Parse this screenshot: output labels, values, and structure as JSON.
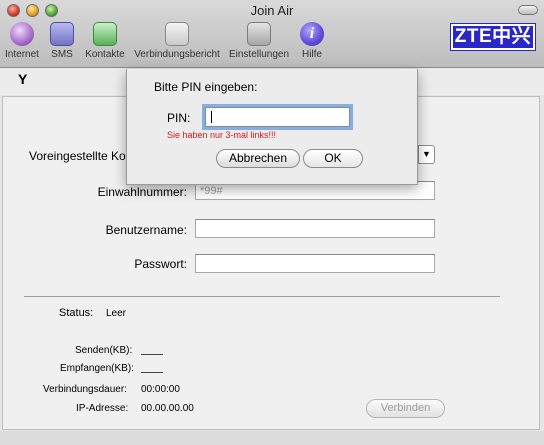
{
  "window": {
    "title": "Join Air"
  },
  "logo": {
    "text": "ZTE中兴",
    "color": "#2a27c9"
  },
  "toolbar": {
    "items": [
      {
        "label": "Internet",
        "icon": "globe-icon"
      },
      {
        "label": "SMS",
        "icon": "envelope-icon"
      },
      {
        "label": "Kontakte",
        "icon": "phone-book-icon"
      },
      {
        "label": "Verbindungsbericht",
        "icon": "report-icon"
      },
      {
        "label": "Einstellungen",
        "icon": "tools-icon"
      },
      {
        "label": "Hilfe",
        "icon": "help-icon",
        "glyph": "i"
      }
    ]
  },
  "signal": {
    "icon": "antenna-icon",
    "glyph": "Y"
  },
  "form": {
    "config_label": "Voreingestellte Ko",
    "dial_label": "Einwahlnummer:",
    "dial_value": "*99#",
    "user_label": "Benutzername:",
    "user_value": "",
    "password_label": "Passwort:",
    "password_value": ""
  },
  "status": {
    "status_label": "Status:",
    "status_value": "Leer",
    "sent_label": "Senden(KB):",
    "received_label": "Empfangen(KB):",
    "duration_label": "Verbindungsdauer:",
    "duration_value": "00:00:00",
    "ip_label": "IP-Adresse:",
    "ip_value": "00.00.00.00",
    "connect_label": "Verbinden"
  },
  "pin_dialog": {
    "title": "Bitte PIN eingeben:",
    "pin_label": "PIN:",
    "pin_value": "",
    "warning": "Sie haben nur 3-mal links!!!",
    "cancel_label": "Abbrechen",
    "ok_label": "OK",
    "warning_color": "#d21b1b"
  }
}
